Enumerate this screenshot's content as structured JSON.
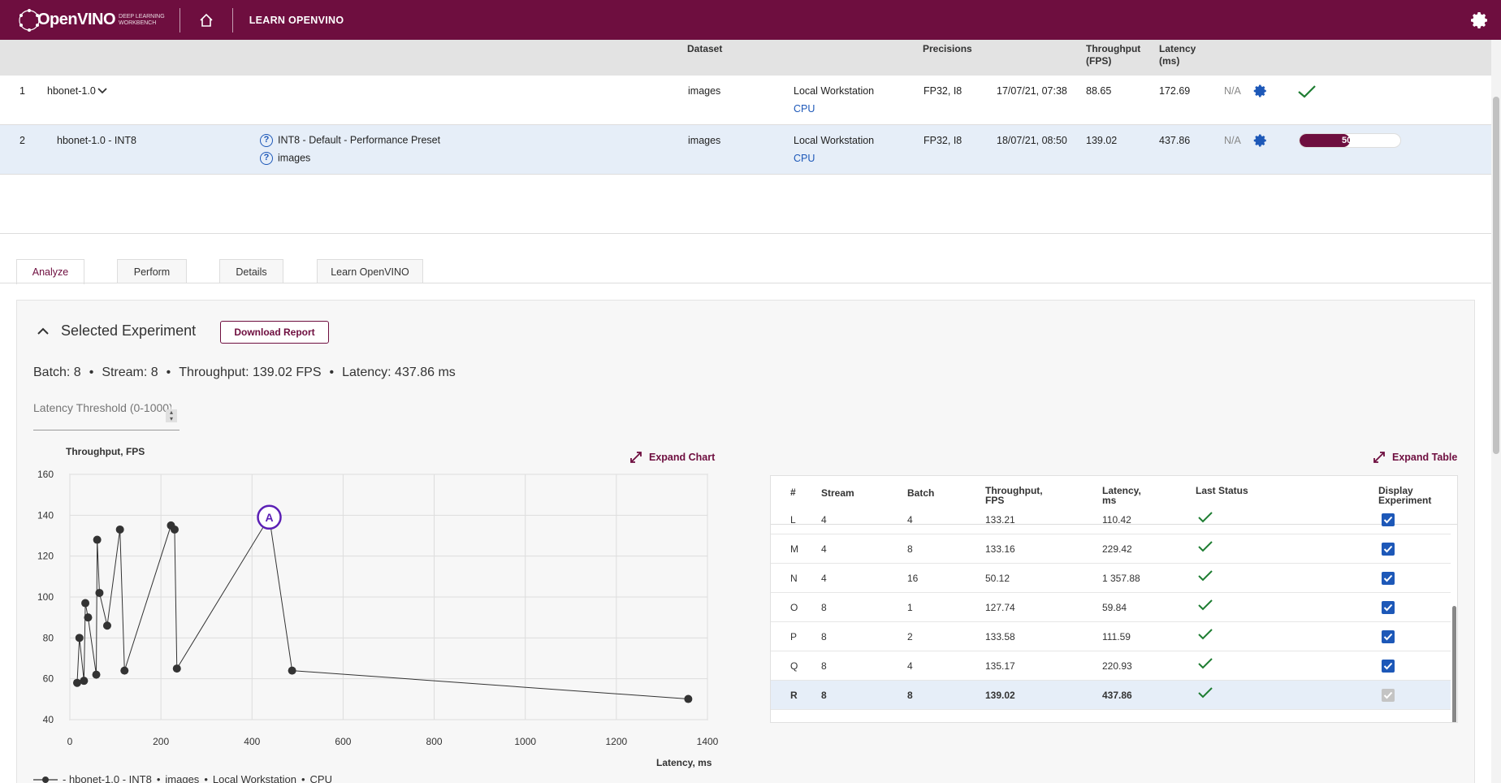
{
  "app": {
    "logo_text": "OpenVINO",
    "logo_sub_1": "DEEP LEARNING",
    "logo_sub_2": "WORKBENCH",
    "learn_link": "LEARN OPENVINO"
  },
  "projects": {
    "headers": {
      "dataset": "Dataset",
      "precisions": "Precisions",
      "throughput_1": "Throughput",
      "throughput_2": "(FPS)",
      "latency_1": "Latency",
      "latency_2": "(ms)"
    },
    "rows": [
      {
        "num": "1",
        "name": "hbonet-1.0",
        "dataset": "images",
        "target": "Local Workstation",
        "device": "CPU",
        "precisions": "FP32, I8",
        "date": "17/07/21, 07:38",
        "throughput": "88.65",
        "latency": "172.69",
        "na": "N/A"
      },
      {
        "num": "2",
        "name": "hbonet-1.0 - INT8",
        "optimization": "INT8 - Default - Performance Preset",
        "opt_dataset": "images",
        "dataset": "images",
        "target": "Local Workstation",
        "device": "CPU",
        "precisions": "FP32, I8",
        "date": "18/07/21, 08:50",
        "throughput": "139.02",
        "latency": "437.86",
        "na": "N/A",
        "progress_label": "50%",
        "progress": 0.5
      }
    ]
  },
  "tabs": [
    "Analyze",
    "Perform",
    "Details",
    "Learn OpenVINO"
  ],
  "selected": {
    "title": "Selected Experiment",
    "download": "Download Report",
    "batch": "Batch: 8",
    "stream": "Stream: 8",
    "throughput": "Throughput: 139.02 FPS",
    "latency": "Latency: 437.86 ms",
    "threshold_placeholder": "Latency Threshold (0-1000)"
  },
  "chart": {
    "expand_label": "Expand Chart",
    "legend": {
      "name": "- hbonet-1.0 - INT8",
      "dataset": "images",
      "target": "Local Workstation",
      "device": "CPU"
    }
  },
  "chart_data": {
    "type": "line",
    "ylabel": "Throughput, FPS",
    "xlabel": "Latency, ms",
    "xlim": [
      0,
      1400
    ],
    "ylim": [
      40,
      160
    ],
    "xticks": [
      0,
      200,
      400,
      600,
      800,
      1000,
      1200,
      1400
    ],
    "yticks": [
      40,
      60,
      80,
      100,
      120,
      140,
      160
    ],
    "grid": true,
    "points": [
      {
        "x": 16,
        "y": 58
      },
      {
        "x": 21,
        "y": 80
      },
      {
        "x": 31,
        "y": 59
      },
      {
        "x": 34,
        "y": 97
      },
      {
        "x": 40,
        "y": 90
      },
      {
        "x": 58,
        "y": 62
      },
      {
        "x": 60,
        "y": 128
      },
      {
        "x": 65,
        "y": 102
      },
      {
        "x": 82,
        "y": 86
      },
      {
        "x": 110,
        "y": 133
      },
      {
        "x": 120,
        "y": 64
      },
      {
        "x": 222,
        "y": 135
      },
      {
        "x": 230,
        "y": 133
      },
      {
        "x": 235,
        "y": 65
      },
      {
        "x": 437.86,
        "y": 139.02,
        "label": "A"
      },
      {
        "x": 488,
        "y": 64
      },
      {
        "x": 1357.88,
        "y": 50.12
      }
    ]
  },
  "results": {
    "expand_label": "Expand Table",
    "headers": {
      "num": "#",
      "stream": "Stream",
      "batch": "Batch",
      "throughput_1": "Throughput,",
      "throughput_2": "FPS",
      "latency_1": "Latency,",
      "latency_2": "ms",
      "status": "Last Status",
      "display_1": "Display",
      "display_2": "Experiment"
    },
    "rows": [
      {
        "id": "L",
        "stream": "4",
        "batch": "4",
        "throughput": "133.21",
        "latency": "110.42"
      },
      {
        "id": "M",
        "stream": "4",
        "batch": "8",
        "throughput": "133.16",
        "latency": "229.42"
      },
      {
        "id": "N",
        "stream": "4",
        "batch": "16",
        "throughput": "50.12",
        "latency": "1 357.88"
      },
      {
        "id": "O",
        "stream": "8",
        "batch": "1",
        "throughput": "127.74",
        "latency": "59.84"
      },
      {
        "id": "P",
        "stream": "8",
        "batch": "2",
        "throughput": "133.58",
        "latency": "111.59"
      },
      {
        "id": "Q",
        "stream": "8",
        "batch": "4",
        "throughput": "135.17",
        "latency": "220.93"
      },
      {
        "id": "R",
        "stream": "8",
        "batch": "8",
        "throughput": "139.02",
        "latency": "437.86"
      }
    ]
  },
  "colors": {
    "brand": "#6e0e3f",
    "link": "#1d58b8",
    "success": "#1e7d32"
  }
}
